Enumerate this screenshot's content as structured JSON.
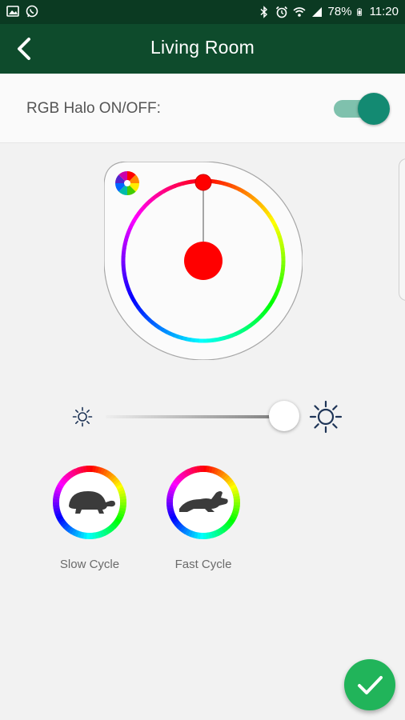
{
  "status_bar": {
    "battery": "78%",
    "time": "11:20",
    "icons": [
      "image-icon",
      "whatsapp-icon",
      "bluetooth-icon",
      "alarm-icon",
      "wifi-icon",
      "signal-icon",
      "battery-icon"
    ]
  },
  "app_bar": {
    "title": "Living Room",
    "back_icon": "chevron-left-icon"
  },
  "halo": {
    "label": "RGB Halo ON/OFF:",
    "on": true
  },
  "color_picker": {
    "selected_color": "#ff0000",
    "palette_icon": "color-palette-icon"
  },
  "brightness": {
    "level_percent": 95,
    "min_icon": "brightness-low-icon",
    "max_icon": "brightness-high-icon"
  },
  "cycles": [
    {
      "label": "Slow Cycle",
      "icon": "turtle-icon"
    },
    {
      "label": "Fast Cycle",
      "icon": "rabbit-icon"
    }
  ],
  "confirm": {
    "icon": "checkmark-icon"
  },
  "colors": {
    "status_bar": "#0b3a22",
    "app_bar": "#0e4b2c",
    "toggle_on": "#138a72",
    "fab": "#21b45a"
  }
}
